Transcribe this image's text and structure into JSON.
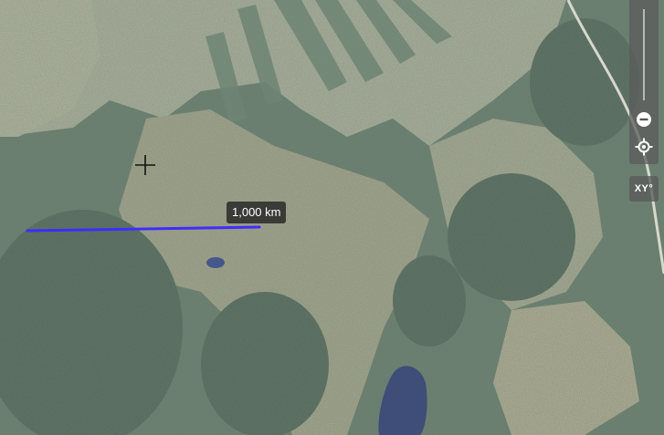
{
  "map": {
    "type": "satellite imagery",
    "colors": {
      "forest": "#5f7466",
      "clearing": "#b0ae94",
      "water": "#3e4e78",
      "measure_line": "#3f2cff"
    }
  },
  "measurement": {
    "label": "1,000 km"
  },
  "controls": {
    "zoom_out_icon": "minus-circle-icon",
    "locate_icon": "crosshair-target-icon",
    "coordinate_toggle_label": "XY°",
    "cursor_icon": "crosshair-cursor-icon"
  }
}
